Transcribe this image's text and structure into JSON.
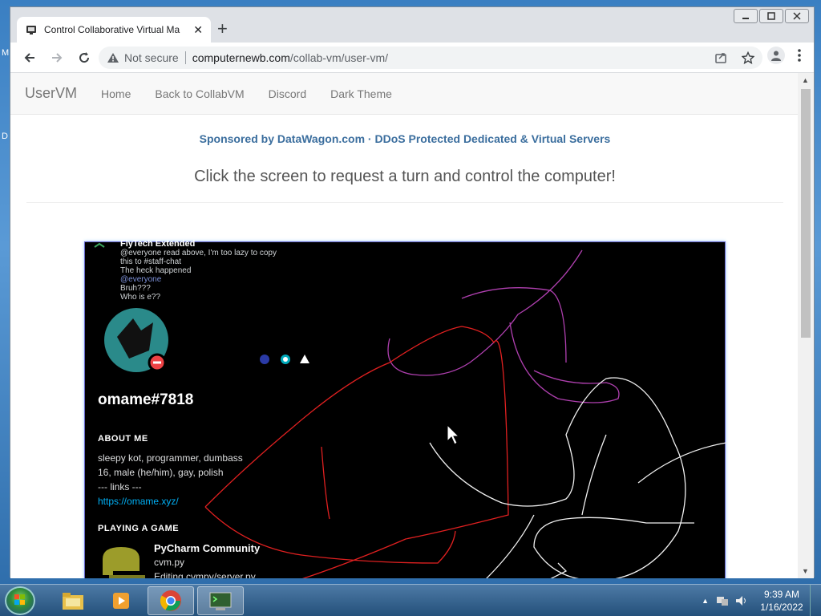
{
  "desktop": {
    "left_labels": [
      "M",
      "D"
    ]
  },
  "browser": {
    "tab_title": "Control Collaborative Virtual Ma",
    "new_tab_label": "+",
    "close_label": "✕",
    "omnibox": {
      "security": "Not secure",
      "host": "computernewb.com",
      "path": "/collab-vm/user-vm/"
    }
  },
  "page": {
    "navbar": {
      "brand": "UserVM",
      "links": [
        "Home",
        "Back to CollabVM",
        "Discord",
        "Dark Theme"
      ]
    },
    "sponsor": "Sponsored by DataWagon.com · DDoS Protected Dedicated & Virtual Servers",
    "headline": "Click the screen to request a turn and control the computer!",
    "vm": {
      "chat_author": "FlyTech Extended",
      "chat_lines": [
        "@everyone read above, I'm too lazy to copy",
        "this to #staff-chat",
        "The heck happened",
        "@everyone",
        "Bruh???",
        "Who is e??"
      ],
      "profile": {
        "username": "omame#7818",
        "about_heading": "ABOUT ME",
        "about_lines": [
          "sleepy kot, programmer, dumbass",
          "16, male (he/him), gay, polish",
          "--- links ---"
        ],
        "link": "https://omame.xyz/",
        "playing_heading": "PLAYING A GAME",
        "game_title": "PyCharm Community",
        "game_line1": "cvm.py",
        "game_line2": "Editing cvmpy/server.py"
      }
    }
  },
  "taskbar": {
    "time": "9:39 AM",
    "date": "1/16/2022"
  }
}
